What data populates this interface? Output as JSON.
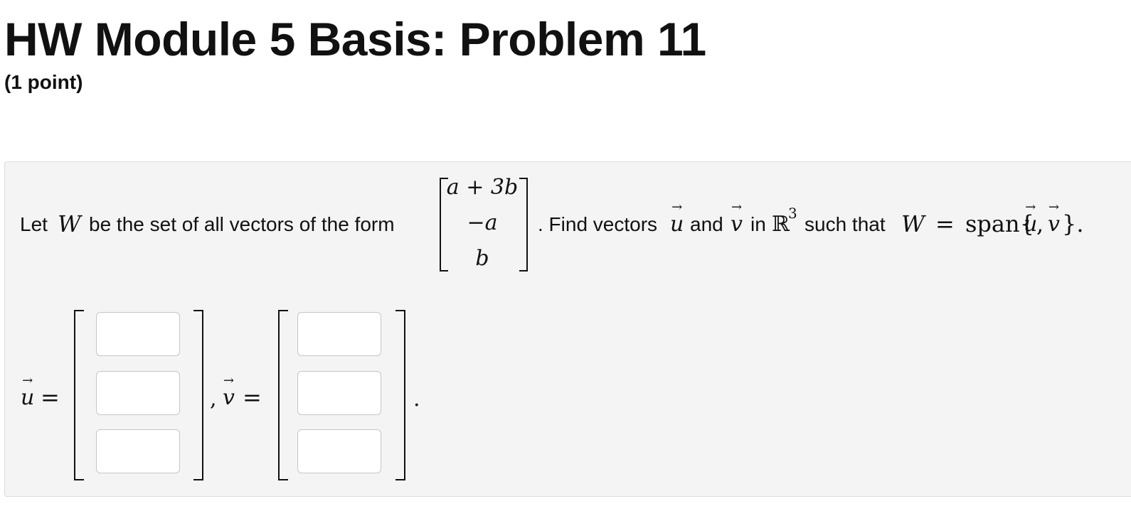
{
  "header": {
    "title": "HW Module 5 Basis: Problem 11",
    "points": "(1 point)"
  },
  "problem": {
    "lead": "Let",
    "W": "W",
    "after_w": "be the set of all vectors of the form",
    "matrix": [
      "a + 3b",
      "−a",
      "b"
    ],
    "find": ". Find vectors",
    "u": "u",
    "and": "and",
    "v": "v",
    "in": "in",
    "R": "ℝ",
    "R_exp": "3",
    "such_that": "such that",
    "W2": "W",
    "equals": "=",
    "span": "span{",
    "comma": ",",
    "close": "}."
  },
  "answer": {
    "u": "u",
    "eq": "=",
    "sep": ",",
    "v": "v",
    "eq2": "=",
    "end": "."
  }
}
